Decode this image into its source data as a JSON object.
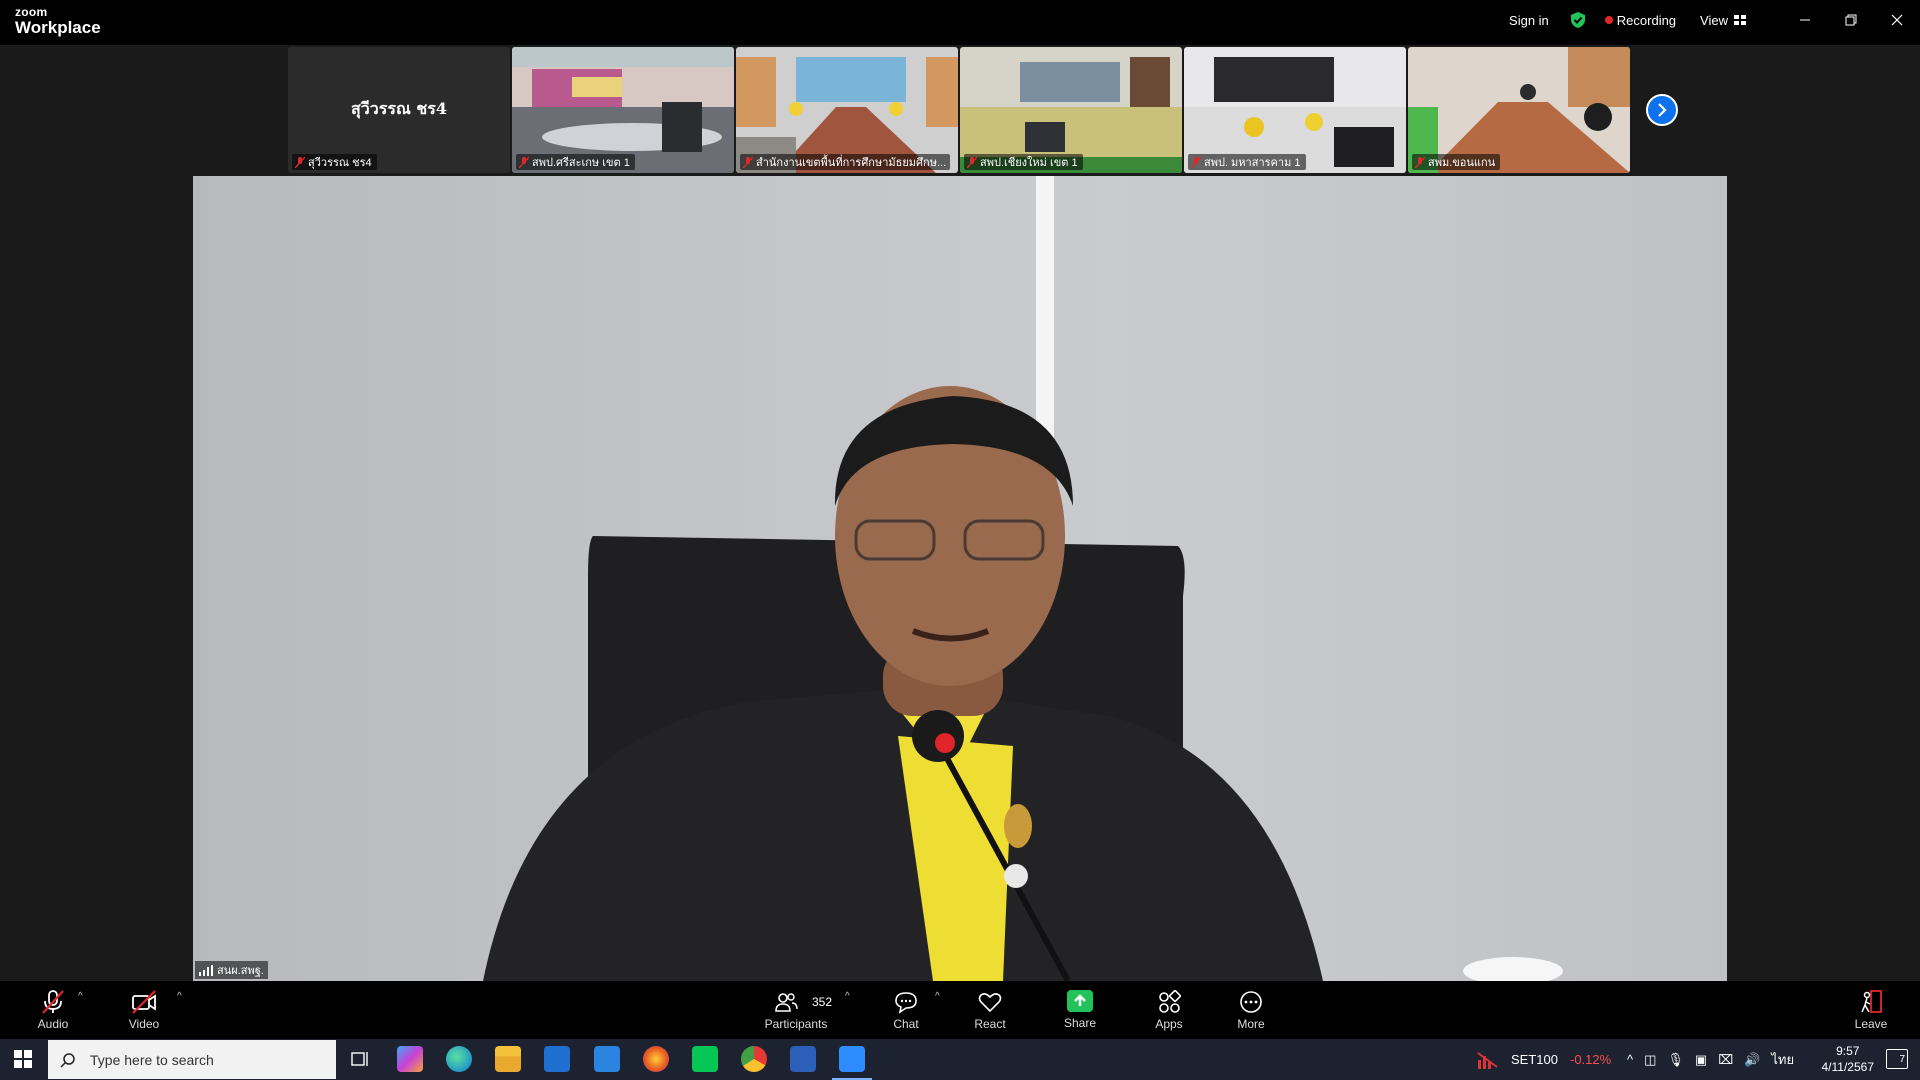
{
  "app": {
    "brand_top": "zoom",
    "brand_bottom": "Workplace"
  },
  "titlebar": {
    "sign_in": "Sign in",
    "recording": "Recording",
    "view": "View"
  },
  "gallery": {
    "tiles": [
      {
        "big_name": "สุวีวรรณ ชร4",
        "label": "สุวีวรรณ ชร4"
      },
      {
        "label": "สพป.ศรีสะเกษ เขต 1"
      },
      {
        "label": "สำนักงานเขตพื้นที่การศึกษามัธยมศึกษ..."
      },
      {
        "label": "สพป.เชียงใหม่ เขต 1"
      },
      {
        "label": "สพป. มหาสารคาม 1"
      },
      {
        "label": "สพม.ขอนแกน"
      }
    ]
  },
  "main": {
    "speaker_label": "สนผ.สพฐ."
  },
  "toolbar": {
    "audio": "Audio",
    "video": "Video",
    "participants": "Participants",
    "participant_count": "352",
    "chat": "Chat",
    "react": "React",
    "share": "Share",
    "apps": "Apps",
    "more": "More",
    "leave": "Leave"
  },
  "taskbar": {
    "search_placeholder": "Type here to search",
    "stock_name": "SET100",
    "stock_change": "-0.12%",
    "language": "ไทย",
    "time": "9:57",
    "date": "4/11/2567",
    "notifications": "7"
  },
  "colors": {
    "accent": "#0e72ed",
    "share_green": "#22c35a",
    "muted_red": "#e02828",
    "stock_down": "#ff4d4d"
  }
}
